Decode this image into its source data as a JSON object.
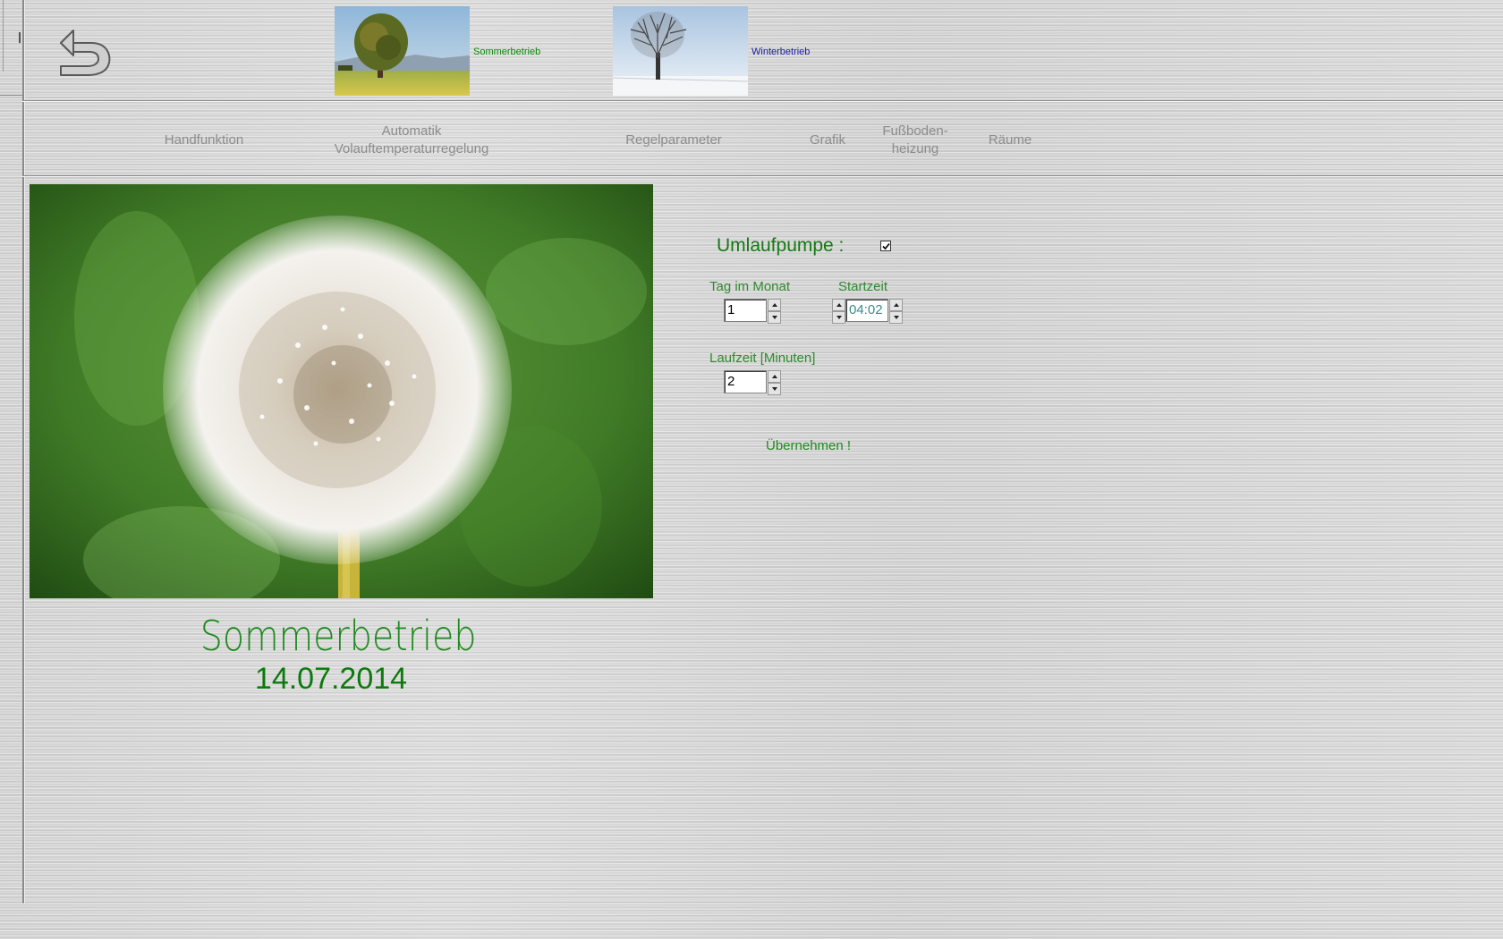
{
  "modes": [
    {
      "label": "Sommerbetrieb",
      "color": "#0a8a0a"
    },
    {
      "label": "Winterbetrieb",
      "color": "#1a1aa0"
    }
  ],
  "nav": {
    "handfunktion": "Handfunktion",
    "automatik_line1": "Automatik",
    "automatik_line2": "Volauftemperaturregelung",
    "regelparameter": "Regelparameter",
    "grafik": "Grafik",
    "fussboden_line1": "Fußboden-",
    "fussboden_line2": "heizung",
    "raeume": "Räume"
  },
  "status": {
    "season": "Sommerbetrieb",
    "date": "14.07.2014"
  },
  "form": {
    "pump_label": "Umlaufpumpe :",
    "pump_checked": true,
    "day_label": "Tag im Monat",
    "day_value": "1",
    "start_label": "Startzeit",
    "start_value": "04:02",
    "runtime_label": "Laufzeit [Minuten]",
    "runtime_value": "2",
    "apply_label": "Übernehmen !"
  },
  "colors": {
    "accent_green": "#2e8b2e",
    "nav_gray": "#8c8c8c",
    "winter_blue": "#1a1aa0"
  },
  "icons": [
    "back-arrow-icon",
    "checkmark-icon",
    "spin-up-icon",
    "spin-down-icon"
  ]
}
